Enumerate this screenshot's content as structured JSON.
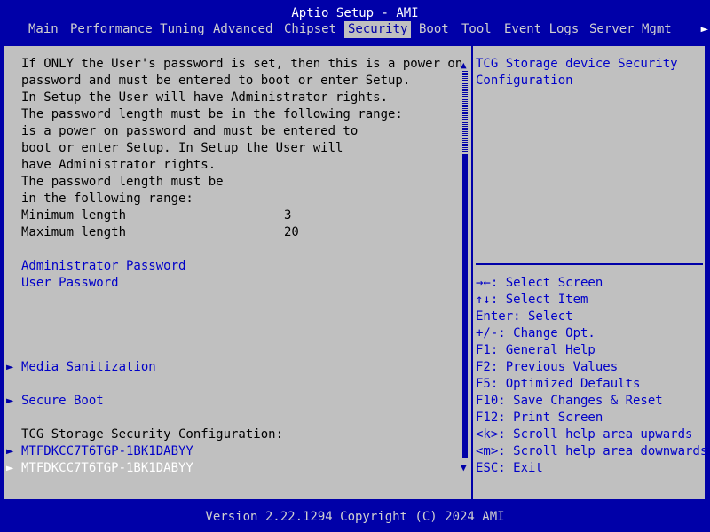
{
  "title": "Aptio Setup - AMI",
  "tabs": [
    {
      "label": "Main"
    },
    {
      "label": "Performance Tuning"
    },
    {
      "label": "Advanced"
    },
    {
      "label": "Chipset"
    },
    {
      "label": "Security"
    },
    {
      "label": "Boot"
    },
    {
      "label": "Tool"
    },
    {
      "label": "Event Logs"
    },
    {
      "label": "Server Mgmt"
    }
  ],
  "tab_more_arrow": "►",
  "description": [
    "If ONLY the User's password is set, then this is a power on",
    "password and must be entered to boot or enter Setup.",
    "In Setup the User will have Administrator rights.",
    "The password length must be in the following range:",
    "is a power on password and must be entered to",
    "boot or enter Setup. In Setup the User will",
    "have Administrator rights.",
    "The password length must be",
    "in the following range:"
  ],
  "min_length": {
    "label": "Minimum length",
    "value": "3"
  },
  "max_length": {
    "label": "Maximum length",
    "value": "20"
  },
  "admin_password": "Administrator Password",
  "user_password": "User Password",
  "media_sanitization": "Media Sanitization",
  "secure_boot": "Secure Boot",
  "tcg_header": "TCG Storage Security Configuration:",
  "drives": [
    {
      "label": "MTFDKCC7T6TGP-1BK1DABYY"
    },
    {
      "label": "MTFDKCC7T6TGP-1BK1DABYY"
    }
  ],
  "submenu_arrow": "►",
  "scroll_up": "▲",
  "scroll_down": "▼",
  "help_text": [
    "TCG Storage device Security",
    "Configuration"
  ],
  "key_help": [
    "→←: Select Screen",
    "↑↓: Select Item",
    "Enter: Select",
    "+/-: Change Opt.",
    "F1: General Help",
    "F2: Previous Values",
    "F5: Optimized Defaults",
    "F10: Save Changes & Reset",
    "F12: Print Screen",
    "<k>: Scroll help area upwards",
    "<m>: Scroll help area downwards",
    "ESC: Exit"
  ],
  "footer": "Version 2.22.1294 Copyright (C) 2024 AMI",
  "colors": {
    "background": "#0000a8",
    "panel": "#c0c0c0",
    "highlight_text": "#0000c8",
    "selected_text": "#ffffff"
  }
}
